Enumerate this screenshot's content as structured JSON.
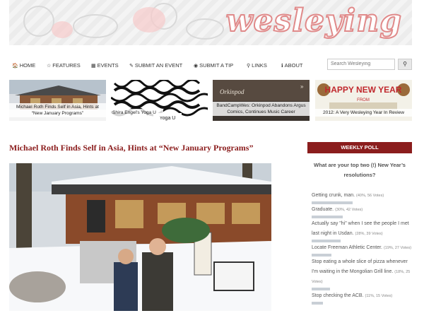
{
  "site": {
    "logo_text": "wesleying",
    "accent": "#8b1d1d"
  },
  "nav": {
    "items": [
      {
        "icon": "🏠",
        "label": "HOME"
      },
      {
        "icon": "☆",
        "label": "FEATURES"
      },
      {
        "icon": "▦",
        "label": "EVENTS"
      },
      {
        "icon": "✎",
        "label": "SUBMIT AN EVENT"
      },
      {
        "icon": "◉",
        "label": "SUBMIT A TIP"
      },
      {
        "icon": "⚲",
        "label": "LINKS"
      },
      {
        "icon": "ℹ",
        "label": "ABOUT"
      }
    ],
    "search_placeholder": "Search Wesleying",
    "search_icon": "search-icon"
  },
  "featured": [
    {
      "caption": "Michael Roth Finds Self in Asia, Hints at “New January Programs”"
    },
    {
      "caption": "Shira Engel’s Yoga U",
      "image_text": "Yoga U"
    },
    {
      "caption": "BandCampWes: Orkinpod Abandons Argus Comics, Continues Music Career",
      "image_text": "Orkinpod"
    },
    {
      "caption": "2012: A Very Wesleying Year In Review",
      "image_text": "HAPPY NEW YEAR",
      "image_subtext": "FROM"
    }
  ],
  "post": {
    "title": "Michael Roth Finds Self in Asia, Hints at “New January Programs”"
  },
  "poll": {
    "heading": "WEEKLY POLL",
    "question": "What are your top two (!) New Year’s resolutions?",
    "options": [
      {
        "label": "Getting crunk, man.",
        "meta": "(40%, 56 Votes)",
        "pct": 40
      },
      {
        "label": "Graduate.",
        "meta": "(30%, 42 Votes)",
        "pct": 30
      },
      {
        "label": "Actually say \"hi\" when I see the people I met last night in Usdan.",
        "meta": "(28%, 39 Votes)",
        "pct": 28
      },
      {
        "label": "Locate Freeman Athletic Center.",
        "meta": "(19%, 27 Votes)",
        "pct": 19
      },
      {
        "label": "Stop eating a whole slice of pizza whenever I'm waiting in the Mongolian Grill line.",
        "meta": "(18%, 25 Votes)",
        "pct": 18
      },
      {
        "label": "Stop checking the ACB.",
        "meta": "(11%, 15 Votes)",
        "pct": 11
      }
    ]
  }
}
